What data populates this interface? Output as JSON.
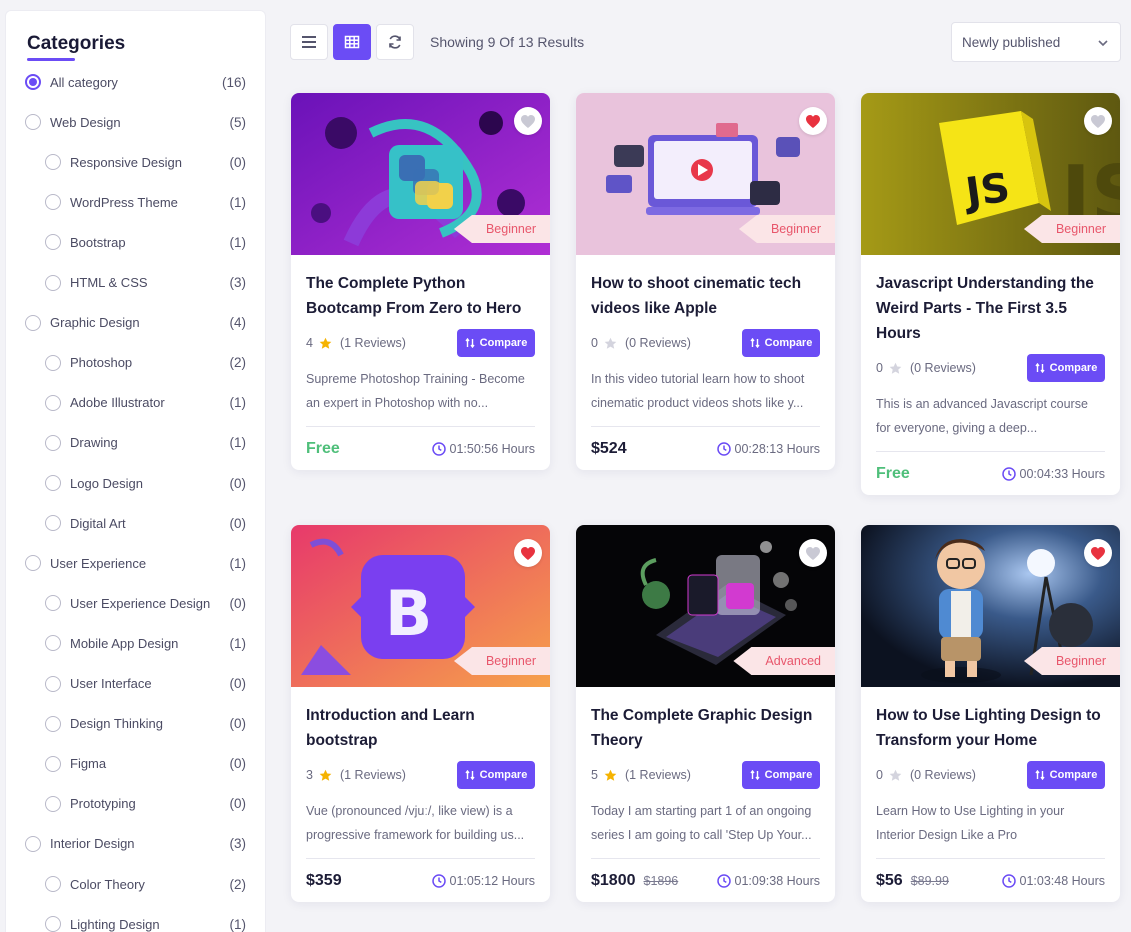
{
  "sidebar": {
    "title": "Categories",
    "items": [
      {
        "label": "All category",
        "count": "(16)",
        "level": 0,
        "checked": true
      },
      {
        "label": "Web Design",
        "count": "(5)",
        "level": 0
      },
      {
        "label": "Responsive Design",
        "count": "(0)",
        "level": 1
      },
      {
        "label": "WordPress Theme",
        "count": "(1)",
        "level": 1
      },
      {
        "label": "Bootstrap",
        "count": "(1)",
        "level": 1
      },
      {
        "label": "HTML & CSS",
        "count": "(3)",
        "level": 1
      },
      {
        "label": "Graphic Design",
        "count": "(4)",
        "level": 0
      },
      {
        "label": "Photoshop",
        "count": "(2)",
        "level": 1
      },
      {
        "label": "Adobe Illustrator",
        "count": "(1)",
        "level": 1
      },
      {
        "label": "Drawing",
        "count": "(1)",
        "level": 1
      },
      {
        "label": "Logo Design",
        "count": "(0)",
        "level": 1
      },
      {
        "label": "Digital Art",
        "count": "(0)",
        "level": 1
      },
      {
        "label": "User Experience",
        "count": "(1)",
        "level": 0
      },
      {
        "label": "User Experience Design",
        "count": "(0)",
        "level": 1
      },
      {
        "label": "Mobile App Design",
        "count": "(1)",
        "level": 1
      },
      {
        "label": "User Interface",
        "count": "(0)",
        "level": 1
      },
      {
        "label": "Design Thinking",
        "count": "(0)",
        "level": 1
      },
      {
        "label": "Figma",
        "count": "(0)",
        "level": 1
      },
      {
        "label": "Prototyping",
        "count": "(0)",
        "level": 1
      },
      {
        "label": "Interior Design",
        "count": "(3)",
        "level": 0
      },
      {
        "label": "Color Theory",
        "count": "(2)",
        "level": 1
      },
      {
        "label": "Lighting Design",
        "count": "(1)",
        "level": 1
      }
    ]
  },
  "toolbar": {
    "list_icon": "list-view-icon",
    "grid_icon": "grid-view-icon",
    "refresh_icon": "refresh-icon",
    "results_text": "Showing 9 Of 13 Results",
    "sort_value": "Newly published"
  },
  "colors": {
    "accent": "#6b4cf5",
    "free": "#4fbf7a",
    "heart_active": "#e8323f",
    "level_bg": "#fbe5e7",
    "level_text": "#e8566b"
  },
  "courses": [
    {
      "title_lines": [
        "The Complete Python",
        "Bootcamp From Zero to Hero"
      ],
      "rating": "4",
      "star_filled": true,
      "reviews": "(1 Reviews)",
      "compare": "Compare",
      "desc_lines": [
        "Supreme Photoshop Training - Become",
        "an expert in Photoshop with no..."
      ],
      "price": "Free",
      "old_price": "",
      "free": true,
      "duration": "01:50:56 Hours",
      "level": "Beginner",
      "favorited": false,
      "thumb": "python"
    },
    {
      "title_lines": [
        "How to shoot cinematic tech",
        "videos like Apple"
      ],
      "rating": "0",
      "star_filled": false,
      "reviews": "(0 Reviews)",
      "compare": "Compare",
      "desc_lines": [
        "In this video tutorial learn how to shoot",
        "cinematic product videos shots like y..."
      ],
      "price": "$524",
      "old_price": "",
      "free": false,
      "duration": "00:28:13 Hours",
      "level": "Beginner",
      "favorited": true,
      "thumb": "video"
    },
    {
      "title_lines": [
        "Javascript Understanding the",
        "Weird Parts - The First 3.5",
        "Hours"
      ],
      "rating": "0",
      "star_filled": false,
      "reviews": "(0 Reviews)",
      "compare": "Compare",
      "desc_lines": [
        "This is an advanced Javascript course",
        "for everyone, giving a deep..."
      ],
      "price": "Free",
      "old_price": "",
      "free": true,
      "duration": "00:04:33 Hours",
      "level": "Beginner",
      "favorited": false,
      "thumb": "js"
    },
    {
      "title_lines": [
        "Introduction and Learn",
        "bootstrap"
      ],
      "rating": "3",
      "star_filled": true,
      "reviews": "(1 Reviews)",
      "compare": "Compare",
      "desc_lines": [
        "Vue (pronounced /vjuː/, like view) is a",
        "progressive framework for building us..."
      ],
      "price": "$359",
      "old_price": "",
      "free": false,
      "duration": "01:05:12 Hours",
      "level": "Beginner",
      "favorited": true,
      "thumb": "bootstrap"
    },
    {
      "title_lines": [
        "The Complete Graphic Design",
        "Theory"
      ],
      "rating": "5",
      "star_filled": true,
      "reviews": "(1 Reviews)",
      "compare": "Compare",
      "desc_lines": [
        "Today I am starting part 1 of an ongoing",
        "series I am going to call 'Step Up Your..."
      ],
      "price": "$1800",
      "old_price": "$1896",
      "free": false,
      "duration": "01:09:38 Hours",
      "level": "Advanced",
      "favorited": false,
      "thumb": "graphic"
    },
    {
      "title_lines": [
        "How to Use Lighting Design to",
        "Transform your Home"
      ],
      "rating": "0",
      "star_filled": false,
      "reviews": "(0 Reviews)",
      "compare": "Compare",
      "desc_lines": [
        "Learn How to Use Lighting in your",
        "Interior Design Like a Pro"
      ],
      "price": "$56",
      "old_price": "$89.99",
      "free": false,
      "duration": "01:03:48 Hours",
      "level": "Beginner",
      "favorited": true,
      "thumb": "lighting"
    }
  ]
}
